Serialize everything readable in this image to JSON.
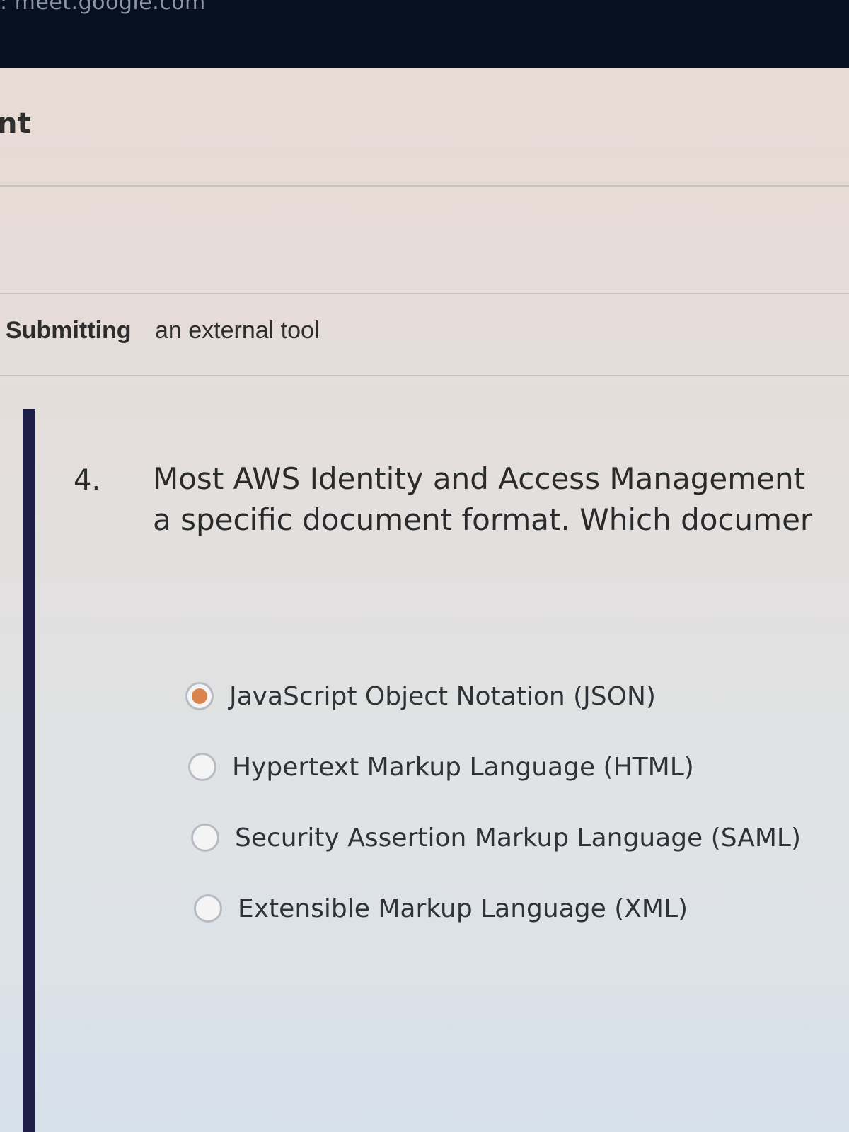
{
  "browser": {
    "url_fragment": ": meet.google.com"
  },
  "nav": {
    "fragment": "nt"
  },
  "submission": {
    "label": "Submitting",
    "value": "an external tool"
  },
  "question": {
    "number": "4.",
    "text_line1": "Most AWS Identity and Access Management",
    "text_line2": "a specific document format. Which documer",
    "options": [
      {
        "label": "JavaScript Object Notation (JSON)",
        "selected": true
      },
      {
        "label": "Hypertext Markup Language (HTML)",
        "selected": false
      },
      {
        "label": "Security Assertion Markup Language (SAML)",
        "selected": false
      },
      {
        "label": "Extensible Markup Language (XML)",
        "selected": false
      }
    ]
  },
  "colors": {
    "selected_radio": "#d9844a",
    "header_bar": "#07101f",
    "accent_rule": "#1d1f48"
  }
}
